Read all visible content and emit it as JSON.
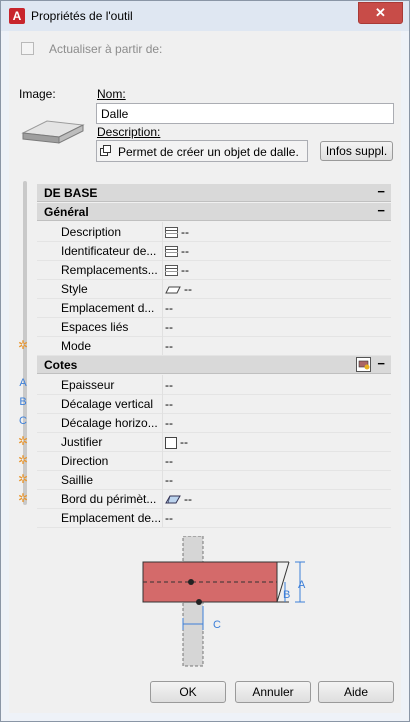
{
  "window": {
    "title": "Propriétés de l'outil",
    "app_icon_letter": "A",
    "close_symbol": "✕"
  },
  "header": {
    "update_label": "Actualiser à partir de:",
    "image_label": "Image:",
    "name_label": "Nom:",
    "name_value": "Dalle",
    "description_label": "Description:",
    "description_value": "Permet de créer un objet de dalle.",
    "more_info_label": "Infos suppl."
  },
  "categories": {
    "base": "DE BASE",
    "general": "Général",
    "dimensions": "Cotes",
    "collapse_symbol": "−"
  },
  "general_rows": [
    {
      "name": "Description",
      "value": "--"
    },
    {
      "name": "Identificateur de...",
      "value": "--"
    },
    {
      "name": "Remplacements...",
      "value": "--"
    },
    {
      "name": "Style",
      "value": "--"
    },
    {
      "name": "Emplacement d...",
      "value": "--"
    },
    {
      "name": "Espaces liés",
      "value": "--"
    },
    {
      "name": "Mode",
      "value": "--",
      "marker": "✲"
    }
  ],
  "dimension_rows": [
    {
      "name": "Epaisseur",
      "value": "--",
      "marker": "A"
    },
    {
      "name": "Décalage vertical",
      "value": "--",
      "marker": "B"
    },
    {
      "name": "Décalage horizo...",
      "value": "--",
      "marker": "C"
    },
    {
      "name": "Justifier",
      "value": "--",
      "marker": "✲"
    },
    {
      "name": "Direction",
      "value": "--",
      "marker": "✲"
    },
    {
      "name": "Saillie",
      "value": "--",
      "marker": "✲"
    },
    {
      "name": "Bord du périmèt...",
      "value": "--",
      "marker": "✲"
    },
    {
      "name": "Emplacement de...",
      "value": "--"
    }
  ],
  "diagram": {
    "label_a": "A",
    "label_b": "B",
    "label_c": "C"
  },
  "buttons": {
    "ok": "OK",
    "cancel": "Annuler",
    "help": "Aide"
  },
  "colors": {
    "slab_fill": "#d46a6a",
    "category_bg": "#d9d9d9",
    "marker_star": "#e8962f",
    "marker_letter": "#3d7fd8",
    "dimension_line": "#3d7fd8"
  }
}
